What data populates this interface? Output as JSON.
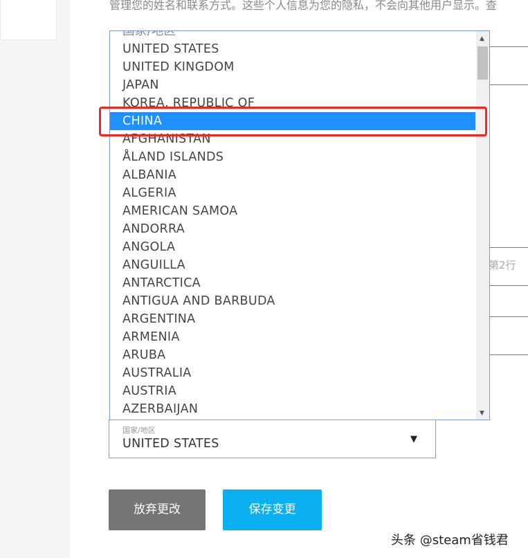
{
  "intro_text": "管理您的姓名和联系方式。这些个人信息为您的隐私，不会向其他用户显示。查",
  "address_hint": "第2行",
  "dropdown": {
    "options": [
      "国家/地区",
      "UNITED STATES",
      "UNITED KINGDOM",
      "JAPAN",
      "KOREA, REPUBLIC OF",
      "CHINA",
      "AFGHANISTAN",
      "ÅLAND ISLANDS",
      "ALBANIA",
      "ALGERIA",
      "AMERICAN SAMOA",
      "ANDORRA",
      "ANGOLA",
      "ANGUILLA",
      "ANTARCTICA",
      "ANTIGUA AND BARBUDA",
      "ARGENTINA",
      "ARMENIA",
      "ARUBA",
      "AUSTRALIA",
      "AUSTRIA",
      "AZERBAIJAN"
    ],
    "highlighted": "CHINA",
    "highlight_color": "#1e90ff",
    "annotation_color": "#f0271f"
  },
  "country_select": {
    "label": "国家/地区",
    "value": "UNITED STATES"
  },
  "buttons": {
    "discard": "放弃更改",
    "save": "保存变更"
  },
  "watermark": "头条 @steam省钱君"
}
